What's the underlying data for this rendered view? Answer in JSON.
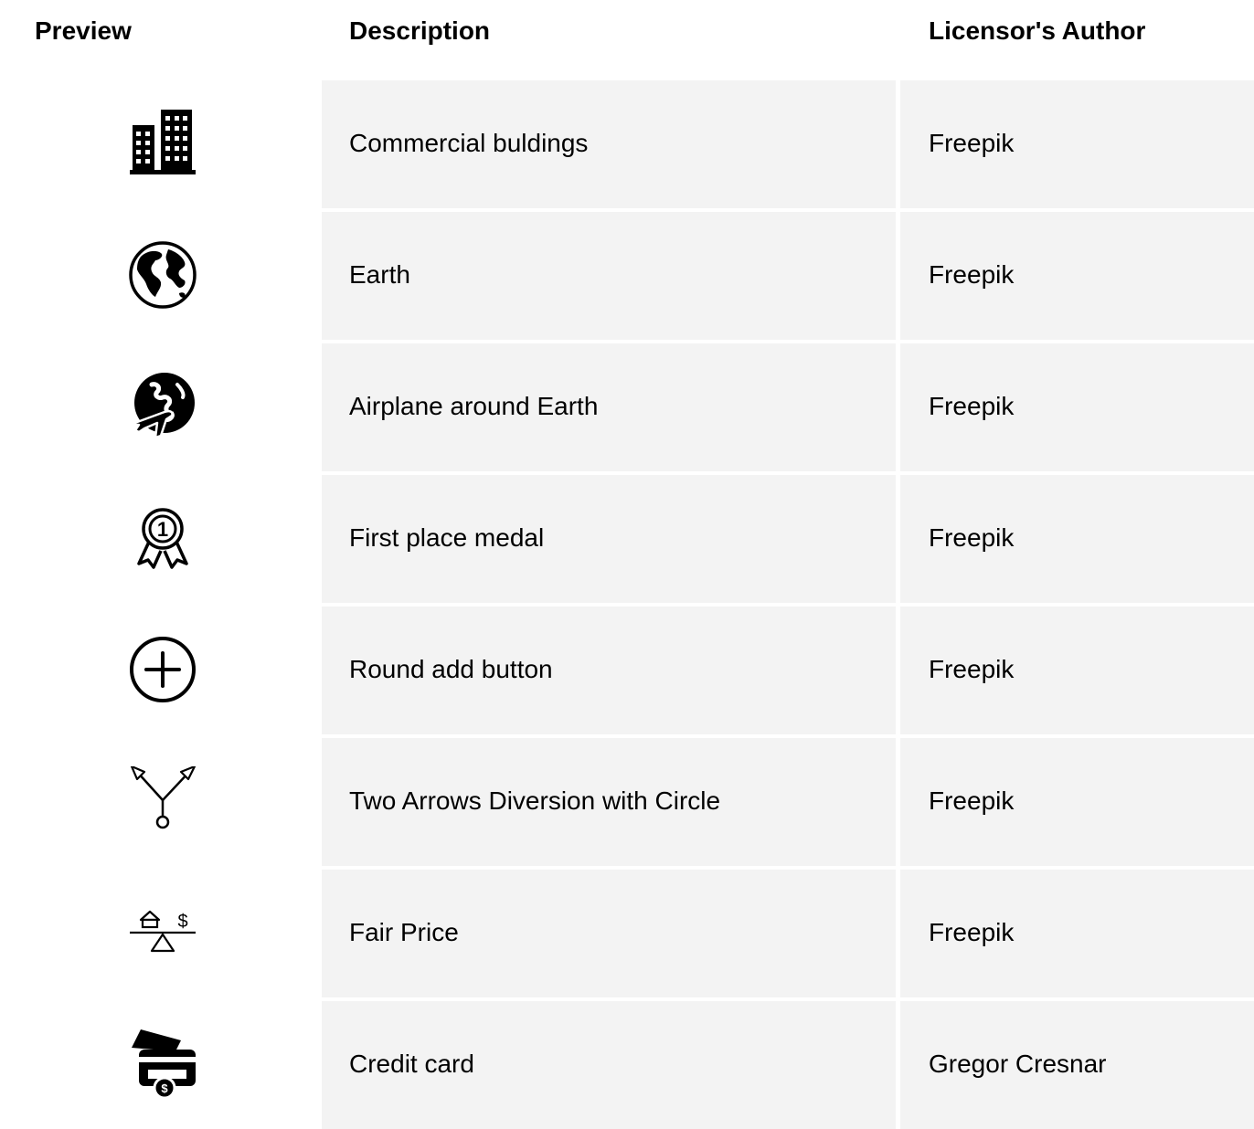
{
  "headers": {
    "preview": "Preview",
    "description": "Description",
    "author": "Licensor's Author"
  },
  "rows": [
    {
      "icon": "commercial-buildings-icon",
      "description": "Commercial buldings",
      "author": "Freepik"
    },
    {
      "icon": "earth-icon",
      "description": "Earth",
      "author": "Freepik"
    },
    {
      "icon": "airplane-around-earth-icon",
      "description": "Airplane around Earth",
      "author": "Freepik"
    },
    {
      "icon": "first-place-medal-icon",
      "description": "First place medal",
      "author": "Freepik"
    },
    {
      "icon": "round-add-button-icon",
      "description": "Round add button",
      "author": "Freepik"
    },
    {
      "icon": "two-arrows-diversion-icon",
      "description": "Two Arrows Diversion with Circle",
      "author": "Freepik"
    },
    {
      "icon": "fair-price-icon",
      "description": "Fair Price",
      "author": "Freepik"
    },
    {
      "icon": "credit-card-icon",
      "description": "Credit card",
      "author": "Gregor Cresnar"
    }
  ]
}
